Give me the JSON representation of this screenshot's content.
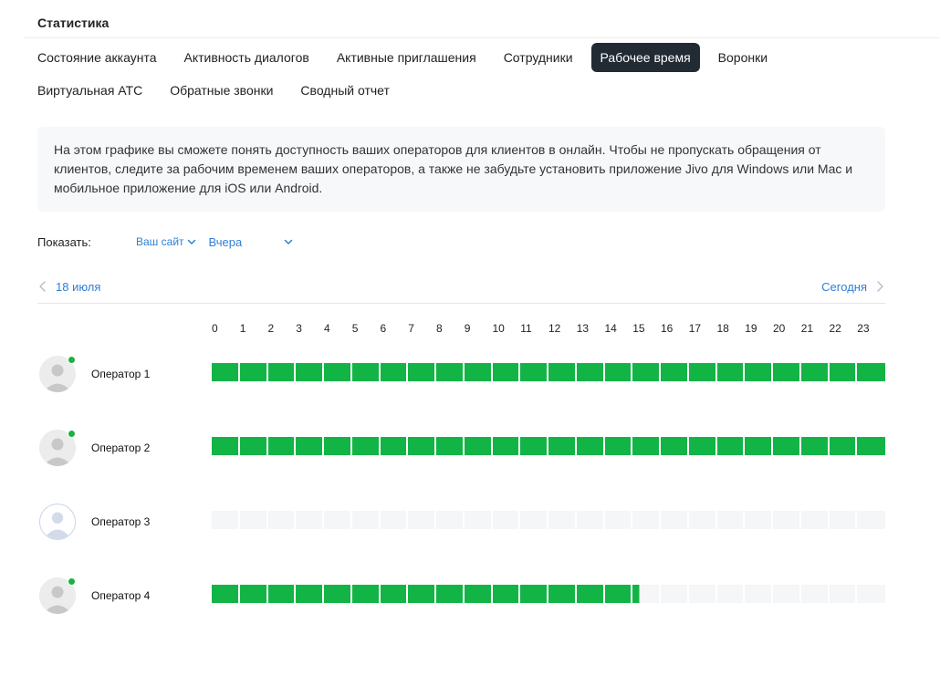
{
  "page": {
    "title": "Статистика"
  },
  "tabs": {
    "row1": [
      {
        "label": "Состояние аккаунта",
        "active": false
      },
      {
        "label": "Активность диалогов",
        "active": false
      },
      {
        "label": "Активные приглашения",
        "active": false
      },
      {
        "label": "Сотрудники",
        "active": false
      },
      {
        "label": "Рабочее время",
        "active": true
      },
      {
        "label": "Воронки",
        "active": false
      }
    ],
    "row2": [
      {
        "label": "Виртуальная АТС",
        "active": false
      },
      {
        "label": "Обратные звонки",
        "active": false
      },
      {
        "label": "Сводный отчет",
        "active": false
      }
    ]
  },
  "info": {
    "text": "На этом графике вы сможете понять доступность ваших операторов для клиентов в онлайн. Чтобы не пропускать обращения от клиентов, следите за рабочим временем ваших операторов, а также не забудьте установить приложение Jivo для Windows или Mac и мобильное приложение для iOS или Android."
  },
  "filters": {
    "label": "Показать:",
    "site": "Ваш сайт",
    "period": "Вчера"
  },
  "date_nav": {
    "prev": "18 июля",
    "next": "Сегодня"
  },
  "hours": [
    "0",
    "1",
    "2",
    "3",
    "4",
    "5",
    "6",
    "7",
    "8",
    "9",
    "10",
    "11",
    "12",
    "13",
    "14",
    "15",
    "16",
    "17",
    "18",
    "19",
    "20",
    "21",
    "22",
    "23"
  ],
  "colors": {
    "online": "#12b446",
    "offline": "#f5f6f7",
    "accent": "#2f7fd6",
    "active_tab": "#222a33"
  },
  "operators": [
    {
      "name": "Оператор 1",
      "online": true,
      "active_hours": 24
    },
    {
      "name": "Оператор 2",
      "online": true,
      "active_hours": 24
    },
    {
      "name": "Оператор 3",
      "online": false,
      "active_hours": 0
    },
    {
      "name": "Оператор 4",
      "online": true,
      "active_hours": 15.25
    }
  ]
}
